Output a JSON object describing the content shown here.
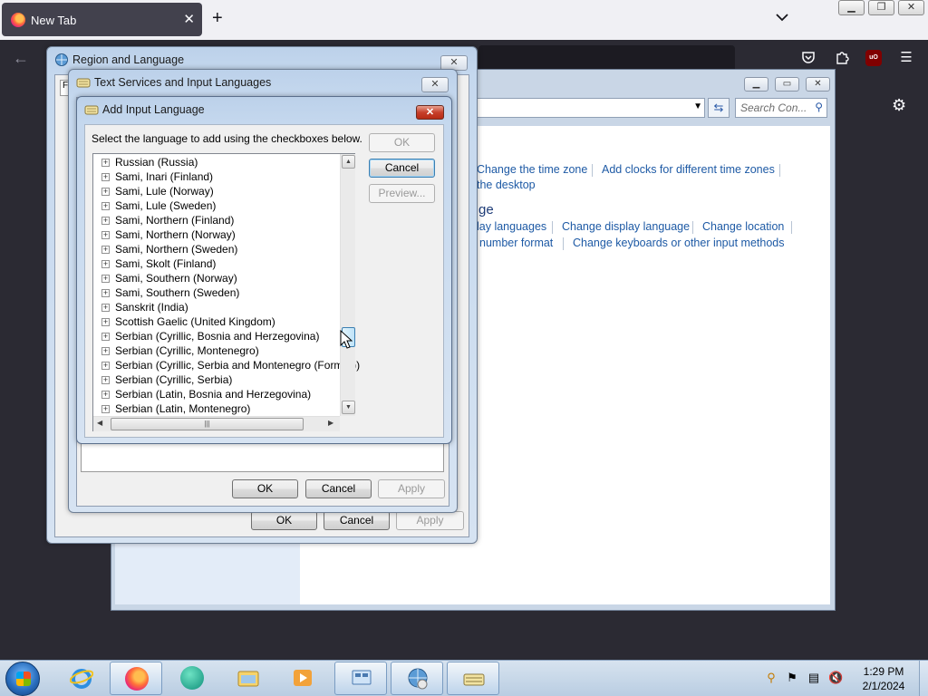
{
  "browser": {
    "tab_title": "New Tab",
    "tab_close": "✕",
    "new_tab": "+",
    "back": "←"
  },
  "control_panel": {
    "search_placeholder": "Search Con...",
    "heading_fragment": "ge",
    "links": {
      "change_time_zone": "Change the time zone",
      "add_clocks": "Add clocks for different time zones",
      "the_desktop": "the desktop",
      "display_languages": "lay languages",
      "change_display_language": "Change display language",
      "change_location": "Change location",
      "number_format": "number format",
      "change_keyboards": "Change keyboards or other input methods"
    }
  },
  "region_dialog": {
    "title": "Region and Language",
    "tab_fragment": "F",
    "ok": "OK",
    "cancel": "Cancel",
    "apply": "Apply"
  },
  "text_services_dialog": {
    "title": "Text Services and Input Languages",
    "ok": "OK",
    "cancel": "Cancel",
    "apply": "Apply"
  },
  "add_language_dialog": {
    "title": "Add Input Language",
    "instruction": "Select the language to add using the checkboxes below.",
    "ok": "OK",
    "cancel": "Cancel",
    "preview": "Preview...",
    "languages": [
      "Russian (Russia)",
      "Sami, Inari (Finland)",
      "Sami, Lule (Norway)",
      "Sami, Lule (Sweden)",
      "Sami, Northern (Finland)",
      "Sami, Northern (Norway)",
      "Sami, Northern (Sweden)",
      "Sami, Skolt (Finland)",
      "Sami, Southern (Norway)",
      "Sami, Southern (Sweden)",
      "Sanskrit (India)",
      "Scottish Gaelic (United Kingdom)",
      "Serbian (Cyrillic, Bosnia and Herzegovina)",
      "Serbian (Cyrillic, Montenegro)",
      "Serbian (Cyrillic, Serbia and Montenegro (Former))",
      "Serbian (Cyrillic, Serbia)",
      "Serbian (Latin, Bosnia and Herzegovina)",
      "Serbian (Latin, Montenegro)"
    ]
  },
  "taskbar": {
    "time": "1:29 PM",
    "date": "2/1/2024"
  }
}
